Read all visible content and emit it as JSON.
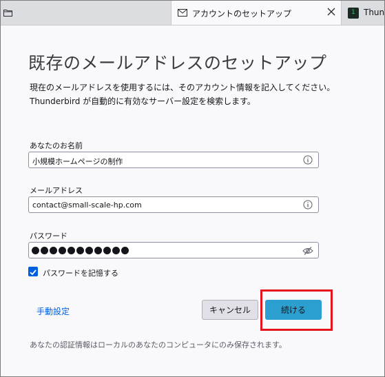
{
  "tabs": {
    "active_title": "アカウントのセットアップ",
    "right_title": "Thun"
  },
  "form": {
    "heading": "既存のメールアドレスのセットアップ",
    "description_line1": "現在のメールアドレスを使用するには、そのアカウント情報を記入してください。",
    "description_line2": "Thunderbird が自動的に有効なサーバー設定を検索します。",
    "name_label": "あなたのお名前",
    "name_value": "小規模ホームページの制作",
    "email_label": "メールアドレス",
    "email_value": "contact@small-scale-hp.com",
    "password_label": "パスワード",
    "password_masked_length": 11,
    "remember_password_label": "パスワードを記憶する",
    "remember_password_checked": true,
    "manual_config_link": "手動設定",
    "cancel_button": "キャンセル",
    "continue_button": "続ける",
    "footnote": "あなたの認証情報はローカルのあなたのコンピュータにのみ保存されます。"
  },
  "colors": {
    "accent": "#0060df",
    "continue_button": "#2ba0d0",
    "highlight_box": "#e5141e"
  }
}
